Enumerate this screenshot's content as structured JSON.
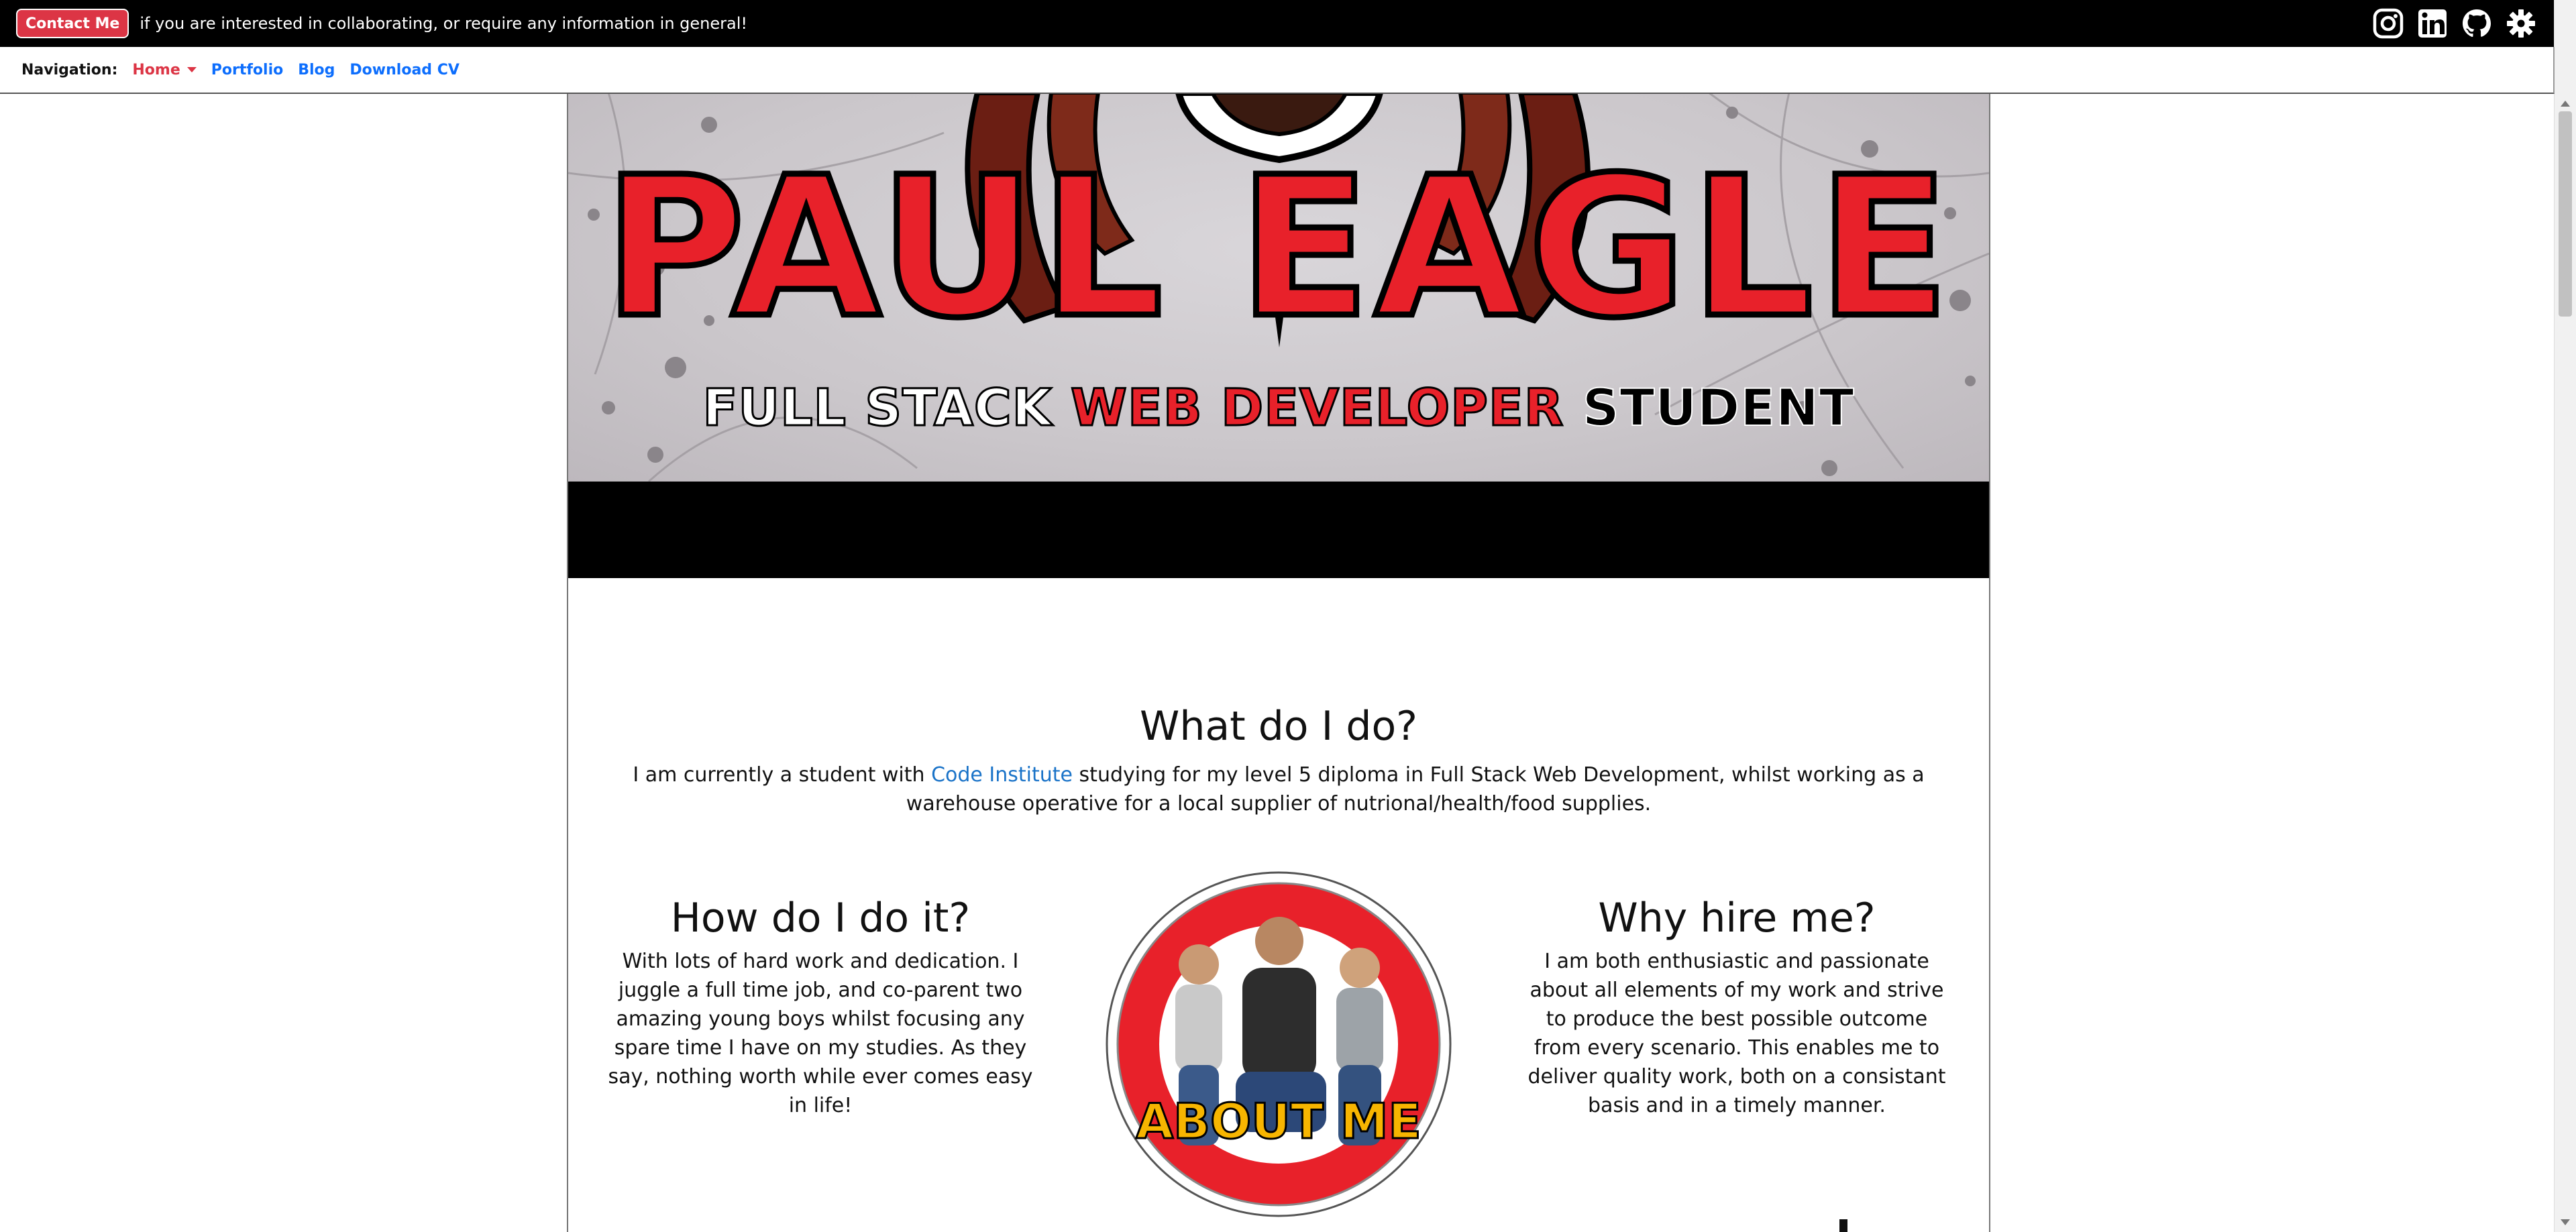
{
  "topbar": {
    "contact_label": "Contact Me",
    "contact_text": "if you are interested in collaborating, or require any information in general!",
    "social_icons": [
      "instagram-icon",
      "linkedin-icon",
      "github-icon",
      "settings-gear-icon"
    ]
  },
  "nav": {
    "label": "Navigation:",
    "items": [
      {
        "label": "Home",
        "active": true,
        "dropdown": true
      },
      {
        "label": "Portfolio"
      },
      {
        "label": "Blog"
      },
      {
        "label": "Download CV"
      }
    ]
  },
  "banner": {
    "name": "PAUL EAGLE",
    "subtitle_part1": "FULL STACK ",
    "subtitle_part2": "WEB DEVELOPER ",
    "subtitle_part3": "STUDENT"
  },
  "what": {
    "heading": "What do I do?",
    "text_before": "I am currently a student with ",
    "link": "Code Institute",
    "text_after": " studying for my level 5 diploma in Full Stack Web Development, whilst working as a warehouse operative for a local supplier of nutrional/health/food supplies."
  },
  "how": {
    "heading": "How do I do it?",
    "text": "With lots of hard work and dedication. I juggle a full time job, and co-parent two amazing young boys whilst focusing any spare time I have on my studies. As they say, nothing worth while ever comes easy in life!"
  },
  "about": {
    "label": "ABOUT ME"
  },
  "why": {
    "heading": "Why hire me?",
    "text": "I am both enthusiastic and passionate about all elements of my work and strive to produce the best possible outcome from every scenario. This enables me to deliver quality work, both on a consistant basis and in a timely manner."
  },
  "colors": {
    "brand_red": "#dc3545",
    "link_blue": "#0d6efd",
    "banner_red": "#e8212a",
    "about_yellow": "#f7b500"
  }
}
